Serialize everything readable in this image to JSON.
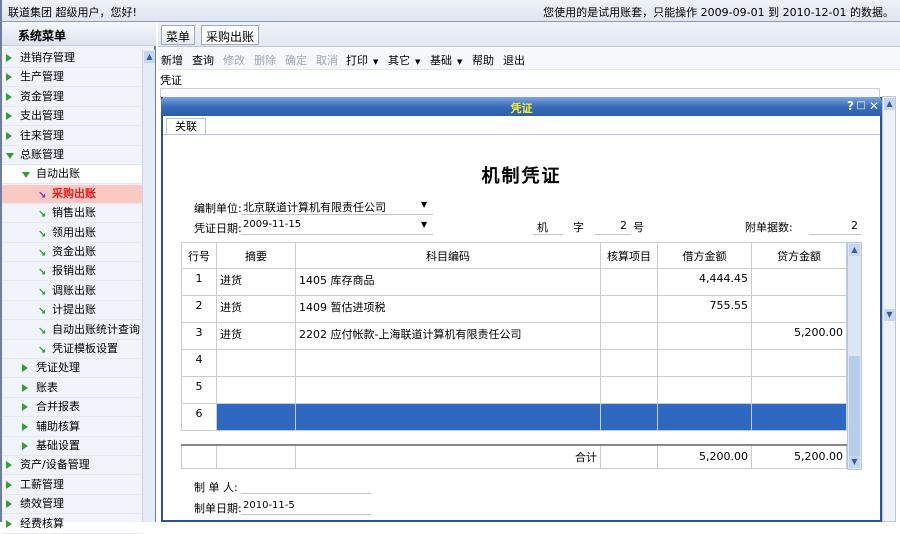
{
  "topbar": {
    "greeting": "联道集团  超级用户，您好!",
    "notice": "您使用的是试用账套，只能操作 2009-09-01 到 2010-12-01 的数据。"
  },
  "sidebar": {
    "title": "系统菜单",
    "items": [
      {
        "label": "进销存管理",
        "level": 0,
        "state": "closed"
      },
      {
        "label": "生产管理",
        "level": 0,
        "state": "closed"
      },
      {
        "label": "资金管理",
        "level": 0,
        "state": "closed"
      },
      {
        "label": "支出管理",
        "level": 0,
        "state": "closed"
      },
      {
        "label": "往来管理",
        "level": 0,
        "state": "closed"
      },
      {
        "label": "总账管理",
        "level": 0,
        "state": "open"
      },
      {
        "label": "自动出账",
        "level": 1,
        "state": "open"
      },
      {
        "label": "采购出账",
        "level": 2,
        "state": "selected"
      },
      {
        "label": "销售出账",
        "level": 2,
        "state": "leaf"
      },
      {
        "label": "领用出账",
        "level": 2,
        "state": "leaf"
      },
      {
        "label": "资金出账",
        "level": 2,
        "state": "leaf"
      },
      {
        "label": "报销出账",
        "level": 2,
        "state": "leaf"
      },
      {
        "label": "调账出账",
        "level": 2,
        "state": "leaf"
      },
      {
        "label": "计提出账",
        "level": 2,
        "state": "leaf"
      },
      {
        "label": "自动出账统计查询",
        "level": 2,
        "state": "leaf"
      },
      {
        "label": "凭证模板设置",
        "level": 2,
        "state": "leaf"
      },
      {
        "label": "凭证处理",
        "level": 1,
        "state": "closed"
      },
      {
        "label": "账表",
        "level": 1,
        "state": "closed"
      },
      {
        "label": "合并报表",
        "level": 1,
        "state": "closed"
      },
      {
        "label": "辅助核算",
        "level": 1,
        "state": "closed"
      },
      {
        "label": "基础设置",
        "level": 1,
        "state": "closed"
      },
      {
        "label": "资产/设备管理",
        "level": 0,
        "state": "closed"
      },
      {
        "label": "工薪管理",
        "level": 0,
        "state": "closed"
      },
      {
        "label": "绩效管理",
        "level": 0,
        "state": "closed"
      },
      {
        "label": "经费核算",
        "level": 0,
        "state": "closed"
      }
    ]
  },
  "tabs": [
    "菜单",
    "采购出账"
  ],
  "toolbar": {
    "new": "新增",
    "query": "查询",
    "edit": "修改",
    "delete": "删除",
    "confirm": "确定",
    "cancel": "取消",
    "print": "打印",
    "other": "其它",
    "basic": "基础",
    "help": "帮助",
    "exit": "退出"
  },
  "section_label": "凭证",
  "dialog": {
    "title": "凭证",
    "tab": "关联",
    "heading": "机制凭证",
    "unit_label": "编制单位:",
    "unit_value": "北京联道计算机有限责任公司",
    "date_label": "凭证日期:",
    "date_value": "2009-11-15",
    "voucher_type": "机",
    "zi": "字",
    "number": "2",
    "hao": "号",
    "attach_label": "附单据数:",
    "attach_value": "2",
    "columns": [
      "行号",
      "摘要",
      "科目编码",
      "核算项目",
      "借方金额",
      "贷方金额"
    ],
    "rows": [
      {
        "no": "1",
        "summary": "进货",
        "account": "1405 库存商品",
        "item": "",
        "debit": "4,444.45",
        "credit": ""
      },
      {
        "no": "2",
        "summary": "进货",
        "account": "1409 暂估进项税",
        "item": "",
        "debit": "755.55",
        "credit": ""
      },
      {
        "no": "3",
        "summary": "进货",
        "account": "2202 应付帐款-上海联道计算机有限责任公司",
        "item": "",
        "debit": "",
        "credit": "5,200.00"
      },
      {
        "no": "4",
        "summary": "",
        "account": "",
        "item": "",
        "debit": "",
        "credit": ""
      },
      {
        "no": "5",
        "summary": "",
        "account": "",
        "item": "",
        "debit": "",
        "credit": ""
      },
      {
        "no": "6",
        "summary": "",
        "account": "",
        "item": "",
        "debit": "",
        "credit": ""
      }
    ],
    "total_label": "合计",
    "total_debit": "5,200.00",
    "total_credit": "5,200.00",
    "maker_label": "制 单 人:",
    "maker_value": "",
    "make_date_label": "制单日期:",
    "make_date_value": "2010-11-5"
  },
  "colors": {
    "title_bar": "#3a6cba",
    "selected_row": "#2f68c0",
    "selected_menu": "#fbc9c4"
  }
}
